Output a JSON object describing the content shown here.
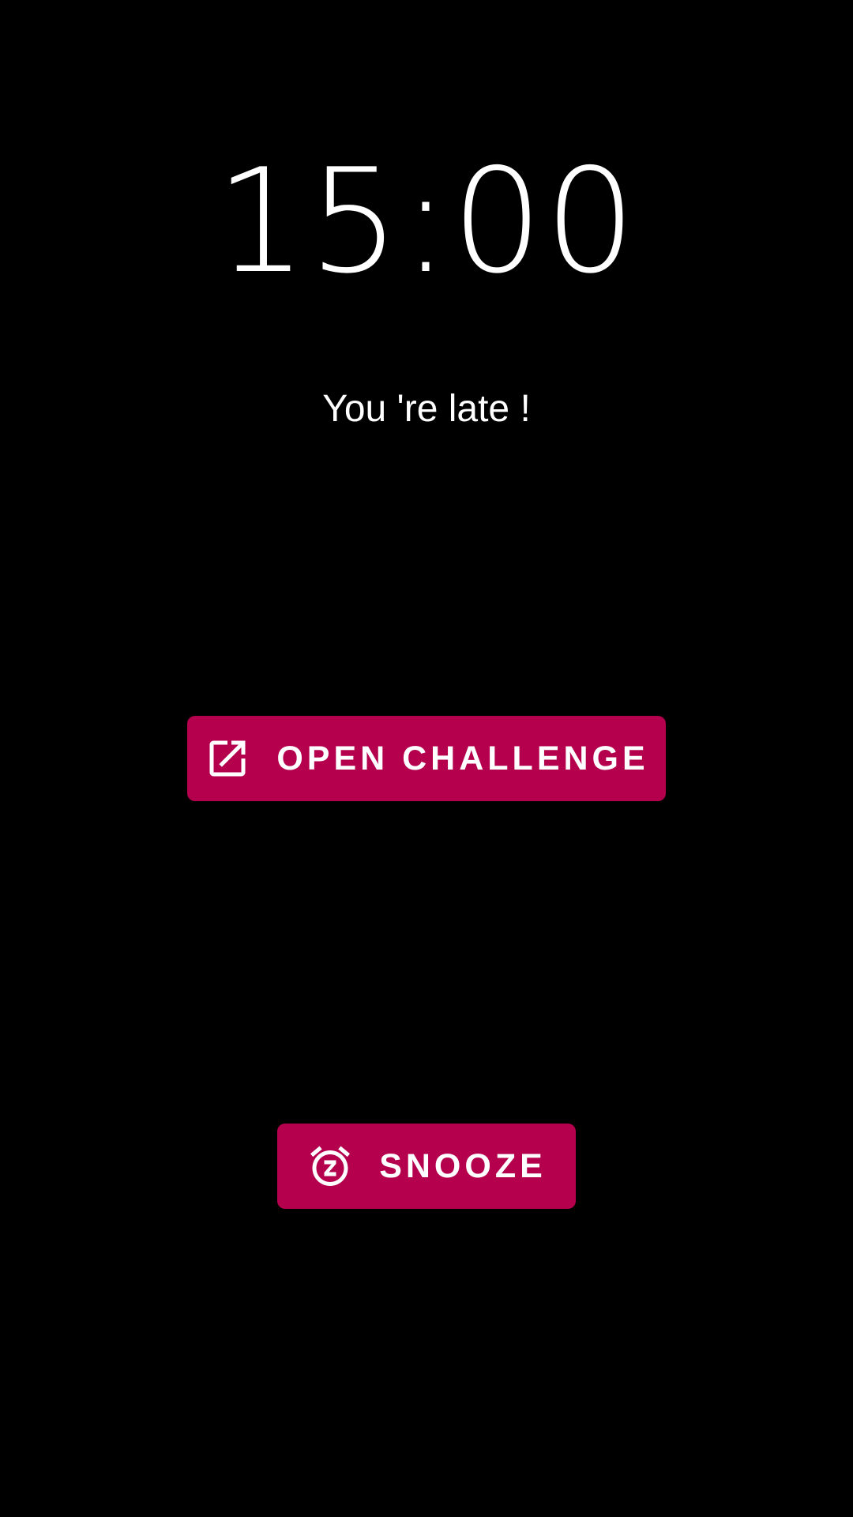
{
  "alarm": {
    "time": "15:00",
    "message": "You 're late !"
  },
  "buttons": {
    "open_challenge": {
      "label": "OPEN CHALLENGE",
      "icon": "open-in-new-icon"
    },
    "snooze": {
      "label": "SNOOZE",
      "icon": "snooze-alarm-icon"
    }
  },
  "colors": {
    "background": "#000000",
    "accent": "#b5004e",
    "text": "#ffffff"
  }
}
